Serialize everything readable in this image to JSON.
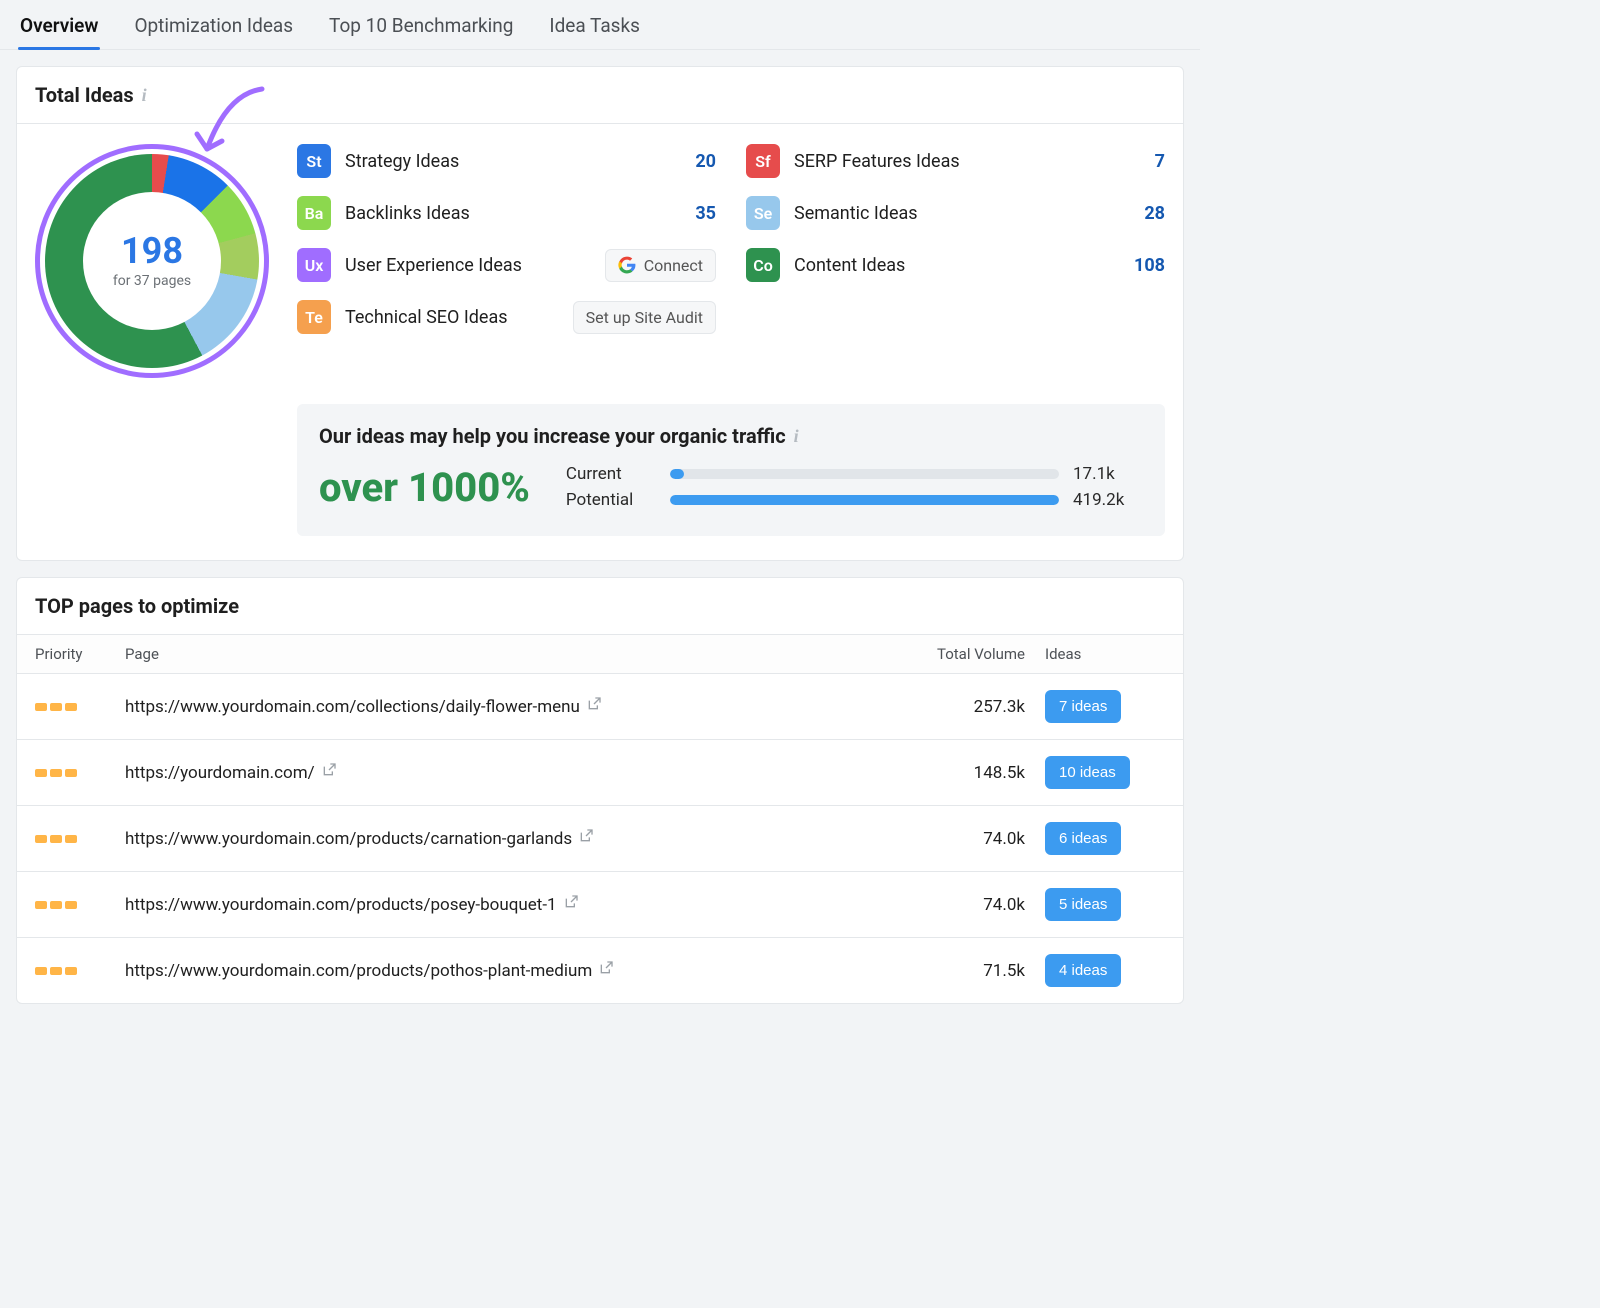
{
  "tabs": [
    "Overview",
    "Optimization Ideas",
    "Top 10 Benchmarking",
    "Idea Tasks"
  ],
  "active_tab": 0,
  "ideas_card": {
    "title": "Total Ideas",
    "total": "198",
    "subtitle": "for 37 pages",
    "items": [
      {
        "badge": "St",
        "color": "#2b77e4",
        "label": "Strategy Ideas",
        "count": "20"
      },
      {
        "badge": "Sf",
        "color": "#e64c4c",
        "label": "SERP Features Ideas",
        "count": "7"
      },
      {
        "badge": "Ba",
        "color": "#8cd84e",
        "label": "Backlinks Ideas",
        "count": "35"
      },
      {
        "badge": "Se",
        "color": "#97c8ec",
        "label": "Semantic Ideas",
        "count": "28"
      },
      {
        "badge": "Ux",
        "color": "#a06dff",
        "label": "User Experience Ideas",
        "action": "connect"
      },
      {
        "badge": "Co",
        "color": "#2e924f",
        "label": "Content Ideas",
        "count": "108"
      },
      {
        "badge": "Te",
        "color": "#f5a04e",
        "label": "Technical SEO Ideas",
        "action": "site_audit"
      }
    ],
    "connect_label": "Connect",
    "site_audit_label": "Set up Site Audit"
  },
  "banner": {
    "heading": "Our ideas may help you increase your organic traffic",
    "big": "over 1000%",
    "current_label": "Current",
    "current_value": "17.1k",
    "potential_label": "Potential",
    "potential_value": "419.2k"
  },
  "pages_card": {
    "title": "TOP pages to optimize",
    "headers": {
      "priority": "Priority",
      "page": "Page",
      "volume": "Total Volume",
      "ideas": "Ideas"
    },
    "rows": [
      {
        "url": "https://www.yourdomain.com/collections/daily-flower-menu",
        "volume": "257.3k",
        "ideas": "7 ideas"
      },
      {
        "url": "https://yourdomain.com/",
        "volume": "148.5k",
        "ideas": "10 ideas"
      },
      {
        "url": "https://www.yourdomain.com/products/carnation-garlands",
        "volume": "74.0k",
        "ideas": "6 ideas"
      },
      {
        "url": "https://www.yourdomain.com/products/posey-bouquet-1",
        "volume": "74.0k",
        "ideas": "5 ideas"
      },
      {
        "url": "https://www.yourdomain.com/products/pothos-plant-medium",
        "volume": "71.5k",
        "ideas": "4 ideas"
      }
    ]
  },
  "chart_data": {
    "type": "pie",
    "title": "Total Ideas",
    "total": 198,
    "series": [
      {
        "name": "Strategy Ideas",
        "value": 20,
        "color": "#2b77e4"
      },
      {
        "name": "SERP Features Ideas",
        "value": 7,
        "color": "#e64c4c"
      },
      {
        "name": "Backlinks Ideas",
        "value": 35,
        "color": "#8cd84e"
      },
      {
        "name": "Semantic Ideas",
        "value": 28,
        "color": "#97c8ec"
      },
      {
        "name": "Content Ideas",
        "value": 108,
        "color": "#2e924f"
      }
    ]
  }
}
